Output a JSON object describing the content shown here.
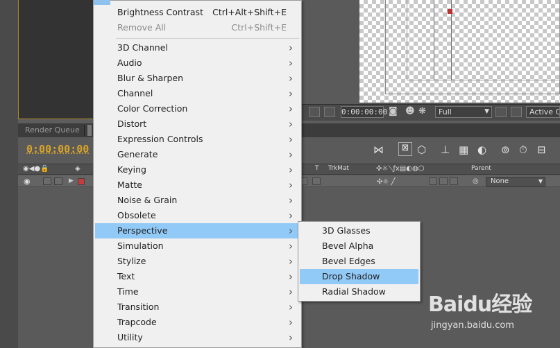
{
  "panels": {
    "render_queue_tab": "Render Queue",
    "timecode": "0:00:00:00"
  },
  "viewer": {
    "timecode": "0:00:00:00",
    "resolution": "Full",
    "camera": "Active Ca"
  },
  "timeline": {
    "columns": {
      "t": "T",
      "trkmat": "TrkMat",
      "parent": "Parent"
    },
    "layer": {
      "parent_value": "None"
    }
  },
  "menu": {
    "items": [
      {
        "label": "Brightness  Contrast",
        "shortcut": "Ctrl+Alt+Shift+E",
        "state": "normal"
      },
      {
        "label": "Remove All",
        "shortcut": "Ctrl+Shift+E",
        "state": "disabled"
      },
      {
        "label": "3D Channel",
        "submenu": true
      },
      {
        "label": "Audio",
        "submenu": true
      },
      {
        "label": "Blur & Sharpen",
        "submenu": true
      },
      {
        "label": "Channel",
        "submenu": true
      },
      {
        "label": "Color Correction",
        "submenu": true
      },
      {
        "label": "Distort",
        "submenu": true
      },
      {
        "label": "Expression Controls",
        "submenu": true
      },
      {
        "label": "Generate",
        "submenu": true
      },
      {
        "label": "Keying",
        "submenu": true
      },
      {
        "label": "Matte",
        "submenu": true
      },
      {
        "label": "Noise & Grain",
        "submenu": true
      },
      {
        "label": "Obsolete",
        "submenu": true
      },
      {
        "label": "Perspective",
        "submenu": true,
        "state": "highlighted"
      },
      {
        "label": "Simulation",
        "submenu": true
      },
      {
        "label": "Stylize",
        "submenu": true
      },
      {
        "label": "Text",
        "submenu": true
      },
      {
        "label": "Time",
        "submenu": true
      },
      {
        "label": "Transition",
        "submenu": true
      },
      {
        "label": "Trapcode",
        "submenu": true
      },
      {
        "label": "Utility",
        "submenu": true
      }
    ],
    "highlight_color": "#91c9f7"
  },
  "submenu": {
    "items": [
      {
        "label": "3D Glasses"
      },
      {
        "label": "Bevel Alpha"
      },
      {
        "label": "Bevel Edges"
      },
      {
        "label": "Drop Shadow",
        "state": "highlighted"
      },
      {
        "label": "Radial Shadow"
      }
    ]
  },
  "watermark": {
    "logo": "Baidu经验",
    "url": "jingyan.baidu.com"
  },
  "colors": {
    "timecode": "#d8a428",
    "menu_bg": "#f0f0f0",
    "panel_bg": "#5d5d5d"
  }
}
